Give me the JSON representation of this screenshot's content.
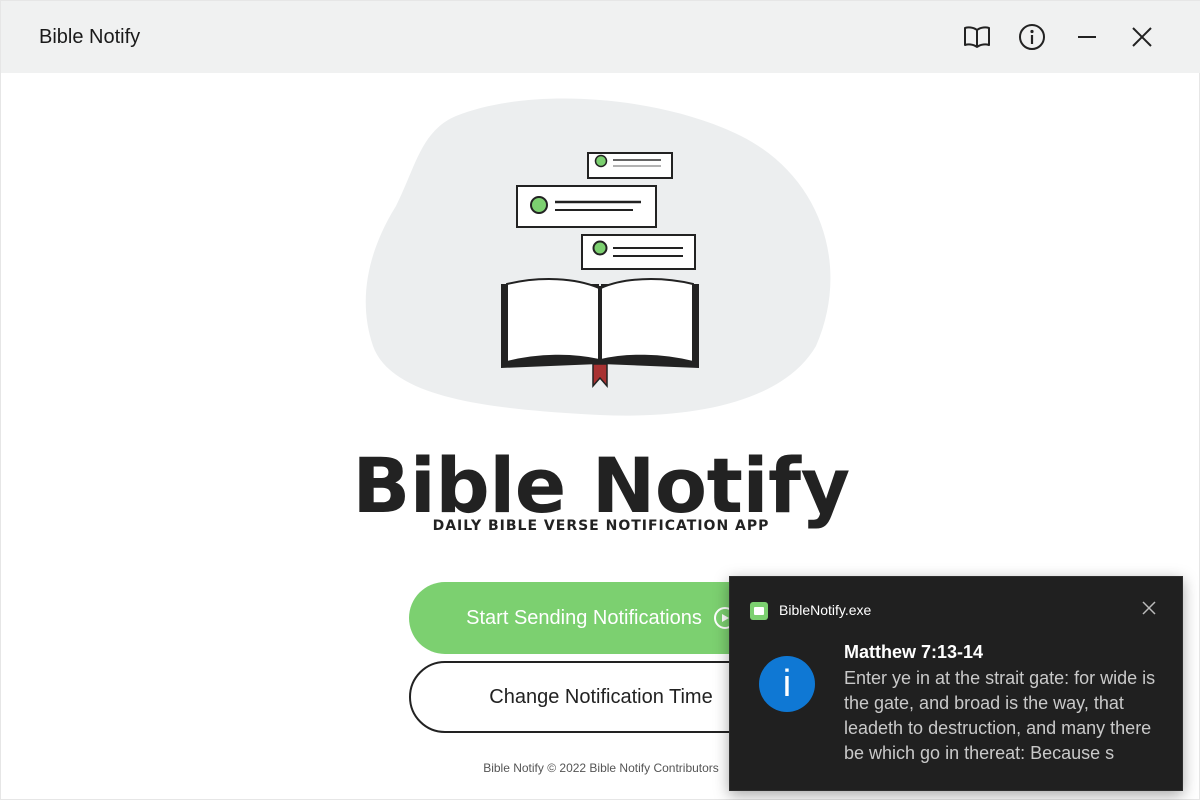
{
  "window": {
    "title": "Bible Notify",
    "controls": {
      "book_icon": "book-icon",
      "info_icon": "info-icon",
      "minimize_icon": "minimize-icon",
      "close_icon": "close-icon"
    }
  },
  "hero": {
    "illustration": "bible-notification-illustration",
    "accent_green": "#7cd070",
    "bookmark_red": "#a83232",
    "blob_gray": "#eceeef"
  },
  "logo": {
    "title": "Bible Notify",
    "tagline": "DAILY BIBLE VERSE NOTIFICATION APP"
  },
  "actions": {
    "start_label": "Start Sending Notifications",
    "start_icon": "play-circle-icon",
    "change_label": "Change Notification Time"
  },
  "footer": {
    "text": "Bible Notify © 2022 Bible Notify Contributors"
  },
  "notification": {
    "app_name": "BibleNotify.exe",
    "title": "Matthew 7:13-14",
    "body": "Enter ye in at the strait gate: for wide is the gate, and broad is the way, that leadeth to destruction, and many there be which go in thereat: Because s",
    "icon": "info-icon",
    "icon_color": "#0f78d4"
  },
  "colors": {
    "titlebar": "#f0f1f1",
    "primary_button": "#7cd070",
    "toast_background": "#202020"
  }
}
